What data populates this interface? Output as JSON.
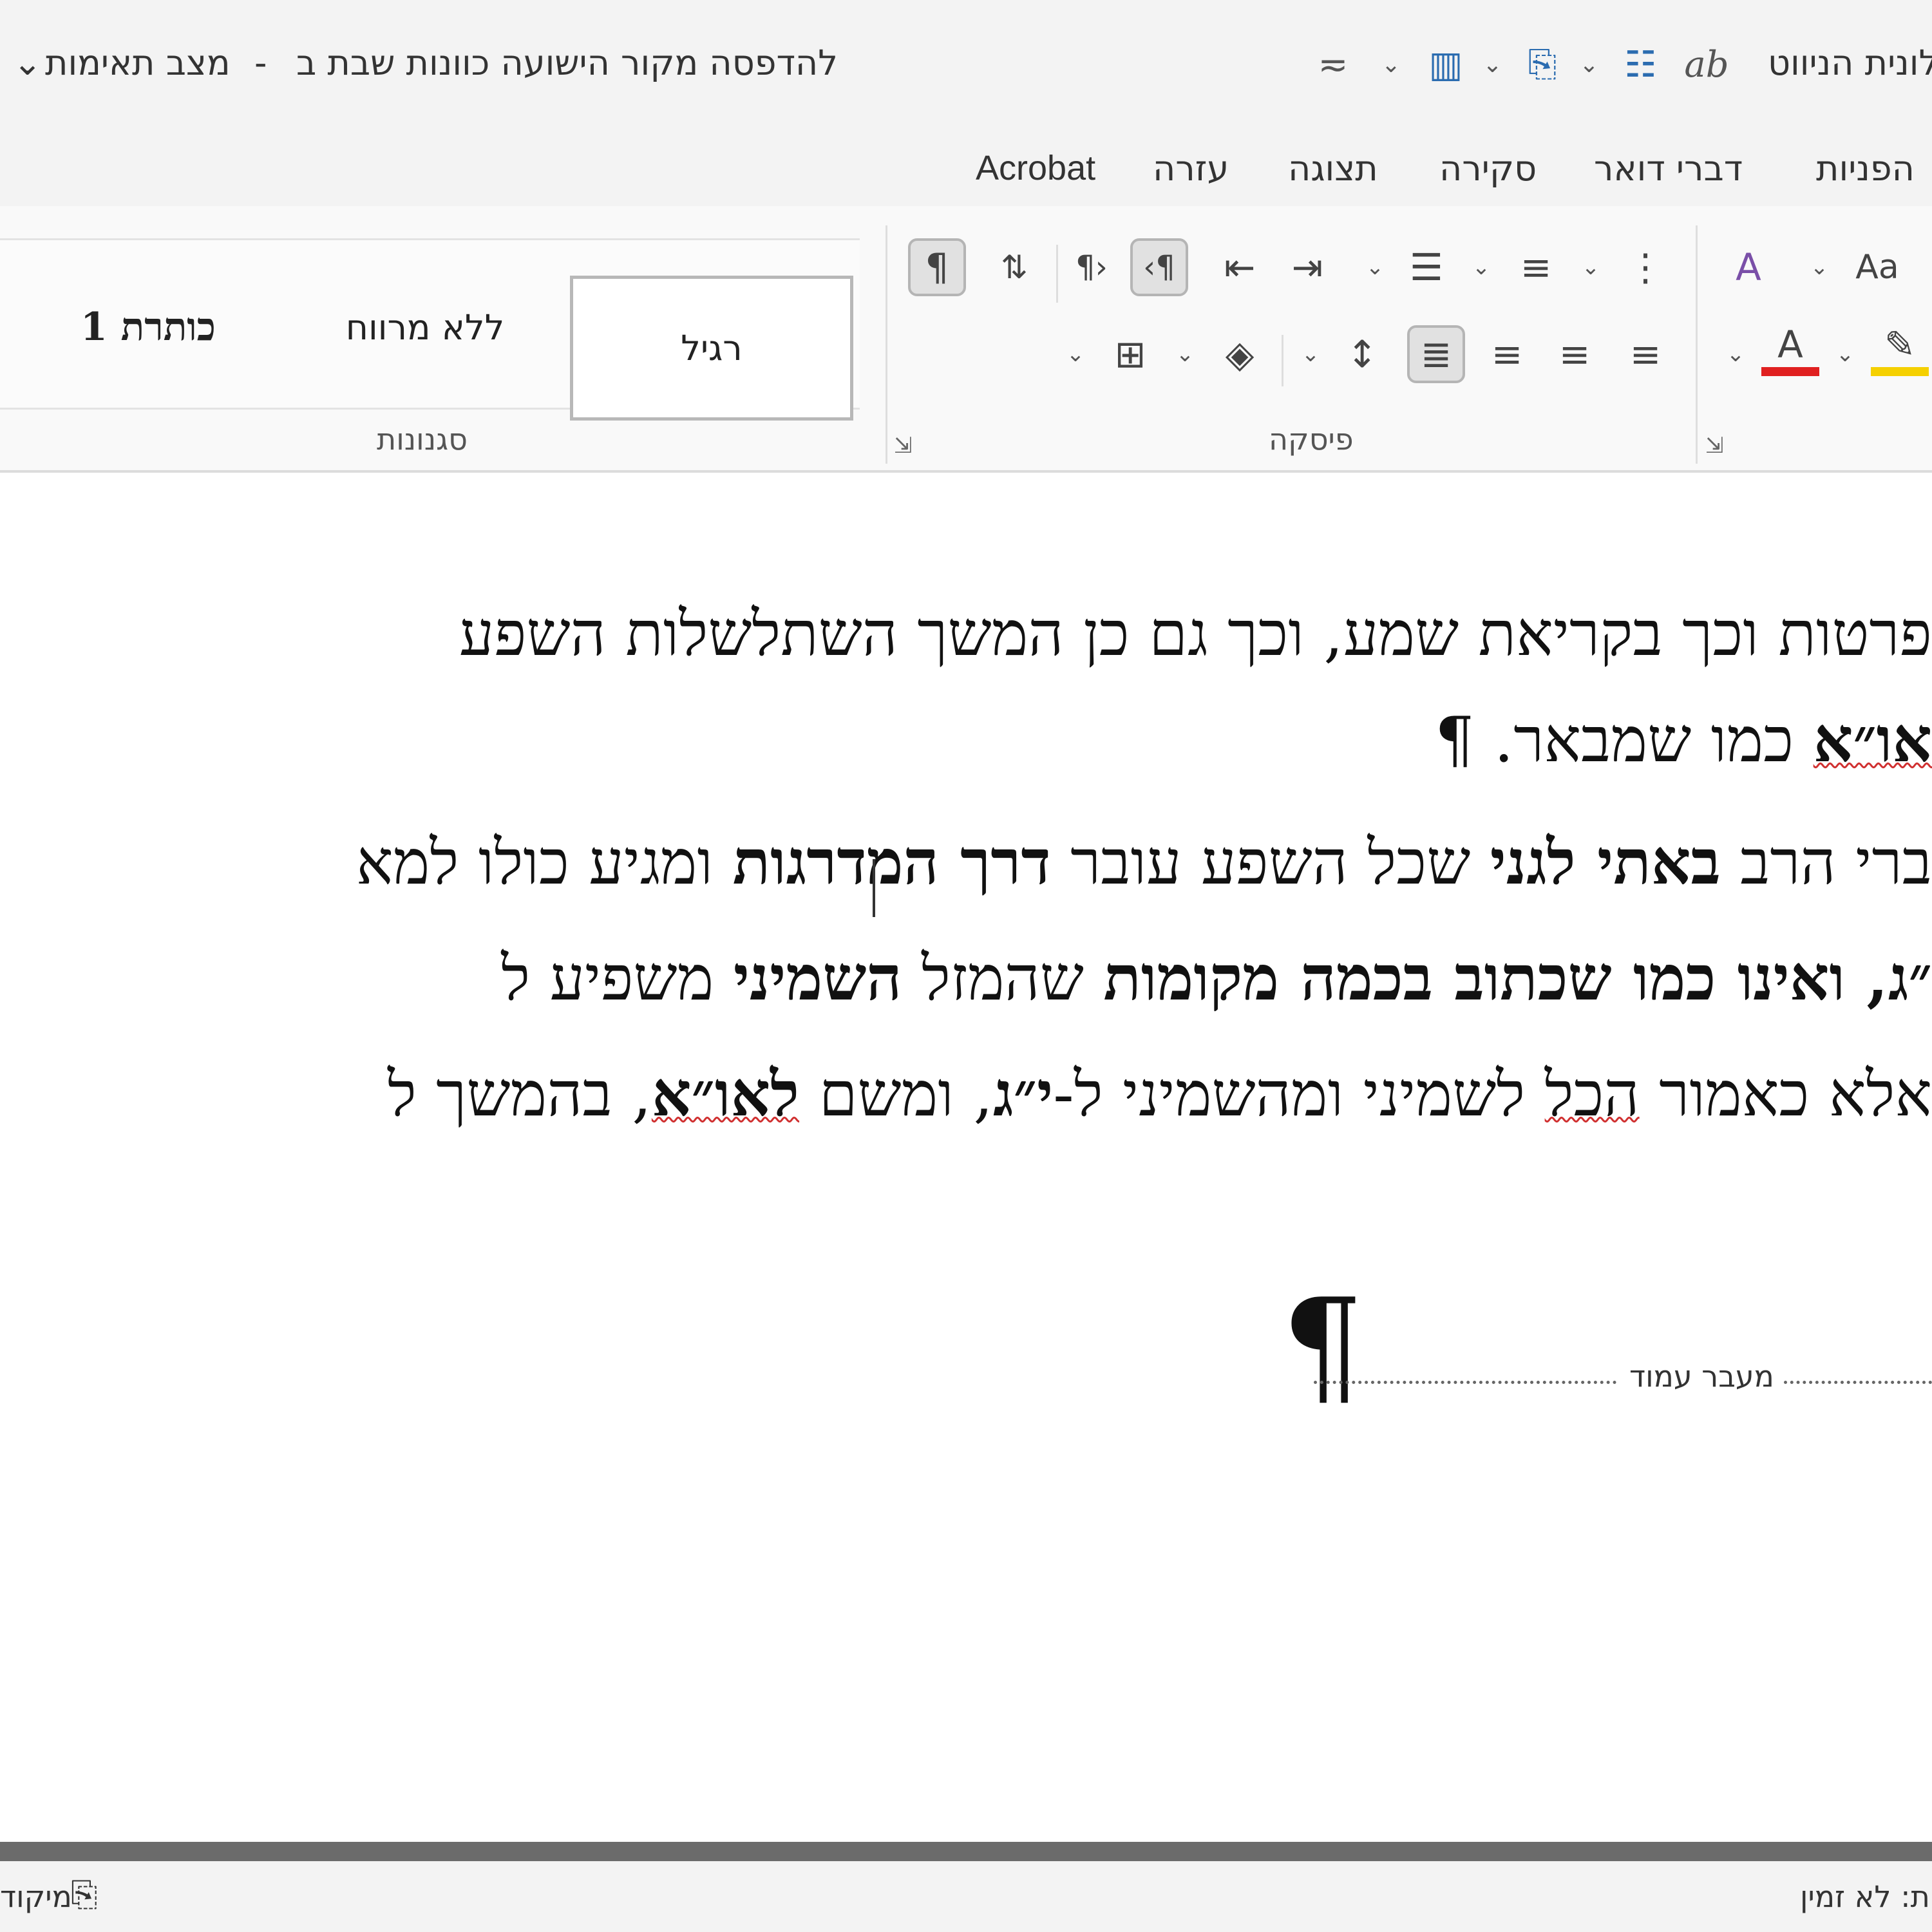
{
  "titlebar": {
    "doc_title": "להדפסה מקור הישועה כוונות שבת ב",
    "separator": "-",
    "status": "מצב תאימות",
    "chevron": "⌄",
    "quick_access_right": "לונית הניווט"
  },
  "tabs": [
    "הפניות",
    "דברי דואר",
    "סקירה",
    "תצוגה",
    "עזרה",
    "Acrobat"
  ],
  "ribbon": {
    "styles": {
      "heading1": "כותרת 1",
      "no_spacing": "ללא מרווח",
      "normal": "רגיל",
      "group_label": "סגנונות"
    },
    "paragraph": {
      "group_label": "פיסקה"
    },
    "font": {
      "case_label": "Aa"
    }
  },
  "document": {
    "line1": "פרטות וכך בקריאת שמע, וכך גם כן המשך השתלשלות השפע",
    "line2_bold": "או״א",
    "line2_text": " כמו שמבאר. ",
    "pilcrow": "¶",
    "line3_a": "ברי הרב ",
    "line3_b": "באתי לגני",
    "line3_c": " שכל השפע עובר ",
    "line3_d": "דרך המדרגות",
    "line3_e": " ומגיע כולו למא",
    "line4_a": "״ג, ואינו כמו שכתוב ",
    "line4_b": "בכמה מקומות",
    "line4_c": " שהמזל ",
    "line4_d": "השמיני",
    "line4_e": " משפיע ל",
    "line5_a": "אלא כאמור ",
    "line5_b": "הכל",
    "line5_c": " לשמיני ומהשמיני ל-",
    "line5_d": "י״ג",
    "line5_e": ", ומשם ",
    "line5_f": "לאו״א",
    "line5_g": ", בהמשך ל",
    "page_break_label": "מעבר עמוד"
  },
  "statusbar": {
    "right": "ת: לא זמין",
    "left": "מיקוד"
  }
}
